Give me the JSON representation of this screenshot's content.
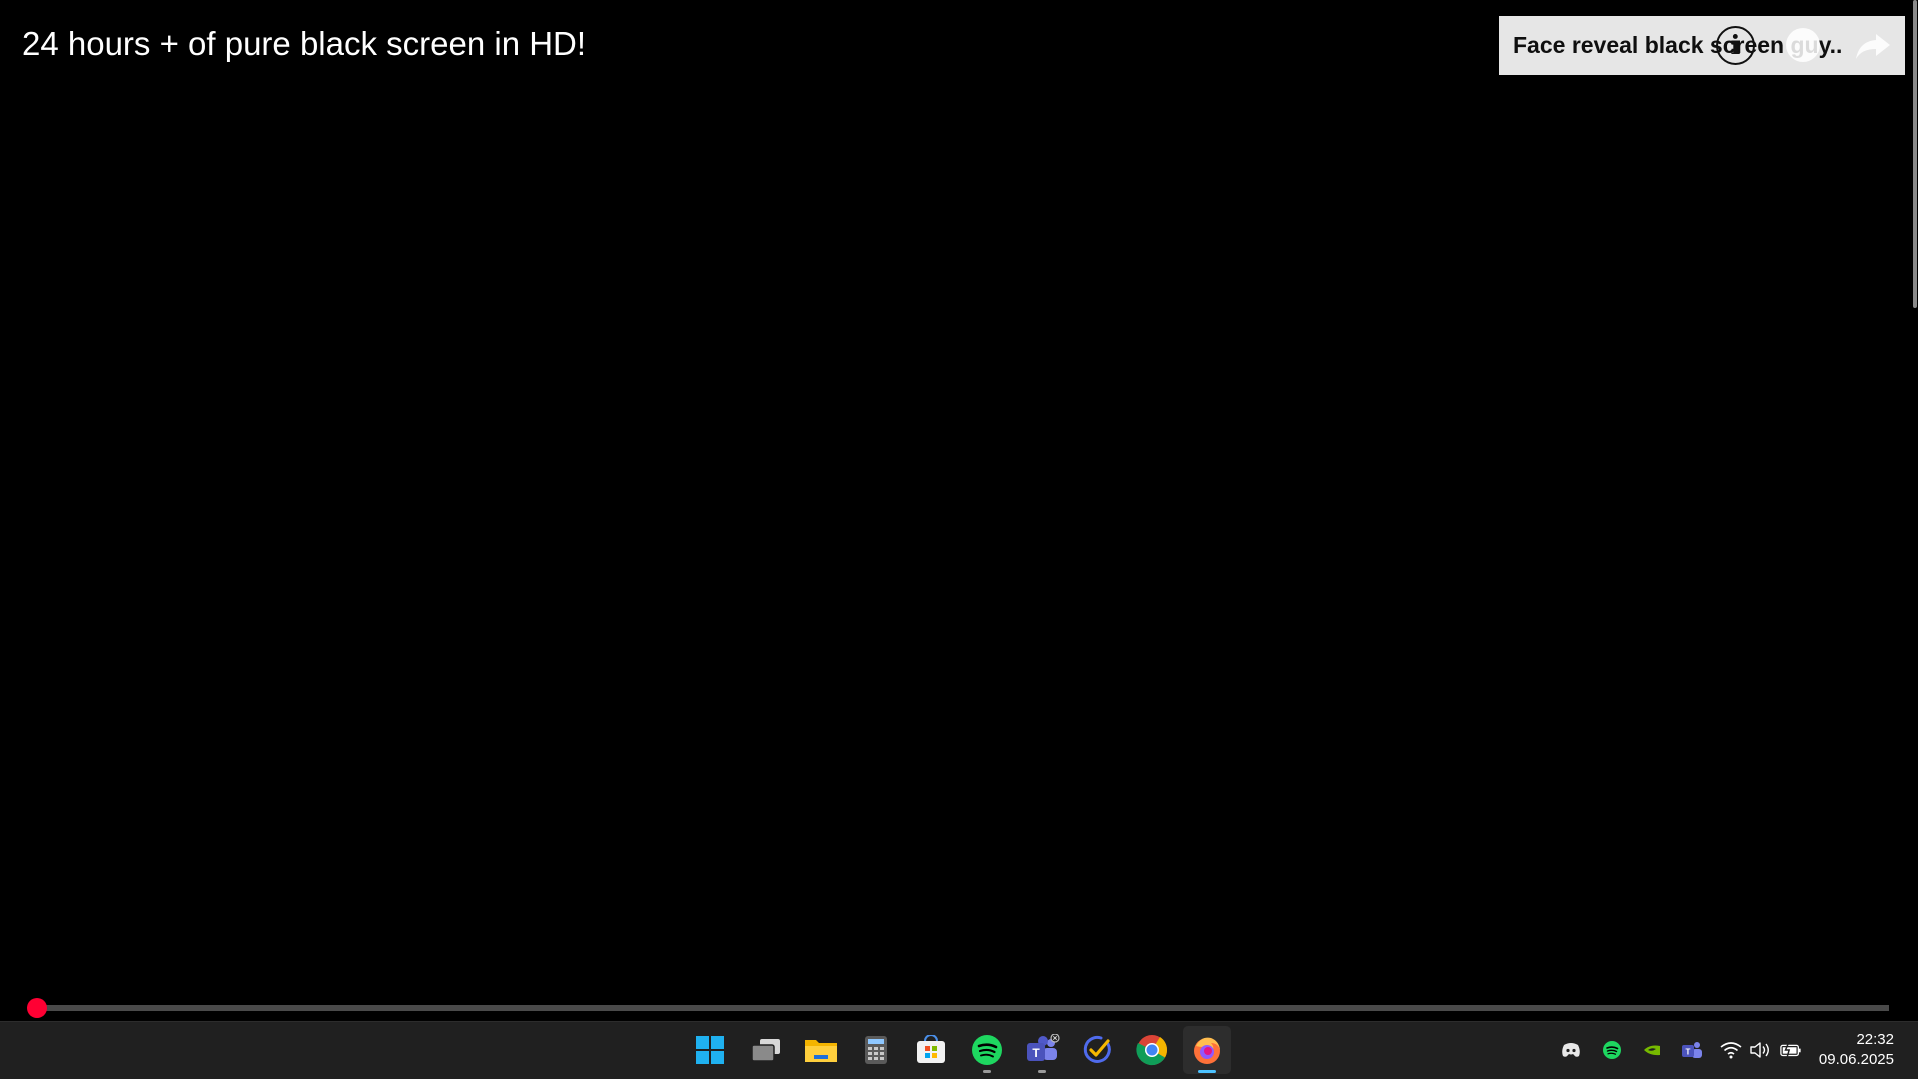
{
  "video": {
    "title": "24 hours + of pure black screen in HD!",
    "progress_percent": 0.5
  },
  "endcard": {
    "text": "Face reveal black screen guy.."
  },
  "icons": {
    "info": "info-icon",
    "watch_later": "clock-icon",
    "share": "share-icon"
  },
  "taskbar": {
    "apps": [
      {
        "name": "Start",
        "icon": "windows-start-icon",
        "state": "idle"
      },
      {
        "name": "Task View",
        "icon": "task-view-icon",
        "state": "idle"
      },
      {
        "name": "File Explorer",
        "icon": "folder-icon",
        "state": "idle"
      },
      {
        "name": "Calculator",
        "icon": "calculator-icon",
        "state": "idle"
      },
      {
        "name": "Microsoft Store",
        "icon": "store-icon",
        "state": "idle"
      },
      {
        "name": "Spotify",
        "icon": "spotify-icon",
        "state": "running"
      },
      {
        "name": "Microsoft Teams",
        "icon": "teams-icon",
        "state": "running"
      },
      {
        "name": "Tasks",
        "icon": "checkmark-app-icon",
        "state": "idle"
      },
      {
        "name": "Google Chrome",
        "icon": "chrome-icon",
        "state": "idle"
      },
      {
        "name": "Firefox",
        "icon": "firefox-icon",
        "state": "focused"
      }
    ],
    "tray": [
      "discord-icon",
      "spotify-tray-icon",
      "nvidia-icon",
      "teams-tray-icon",
      "wifi-icon",
      "volume-icon",
      "battery-icon"
    ],
    "clock": {
      "time": "22:32",
      "date": "09.06.2025"
    }
  },
  "colors": {
    "progress": "#ff0000",
    "scrubber": "#ff0033",
    "taskbar_bg": "#202020",
    "focus_indicator": "#4cc2ff"
  }
}
